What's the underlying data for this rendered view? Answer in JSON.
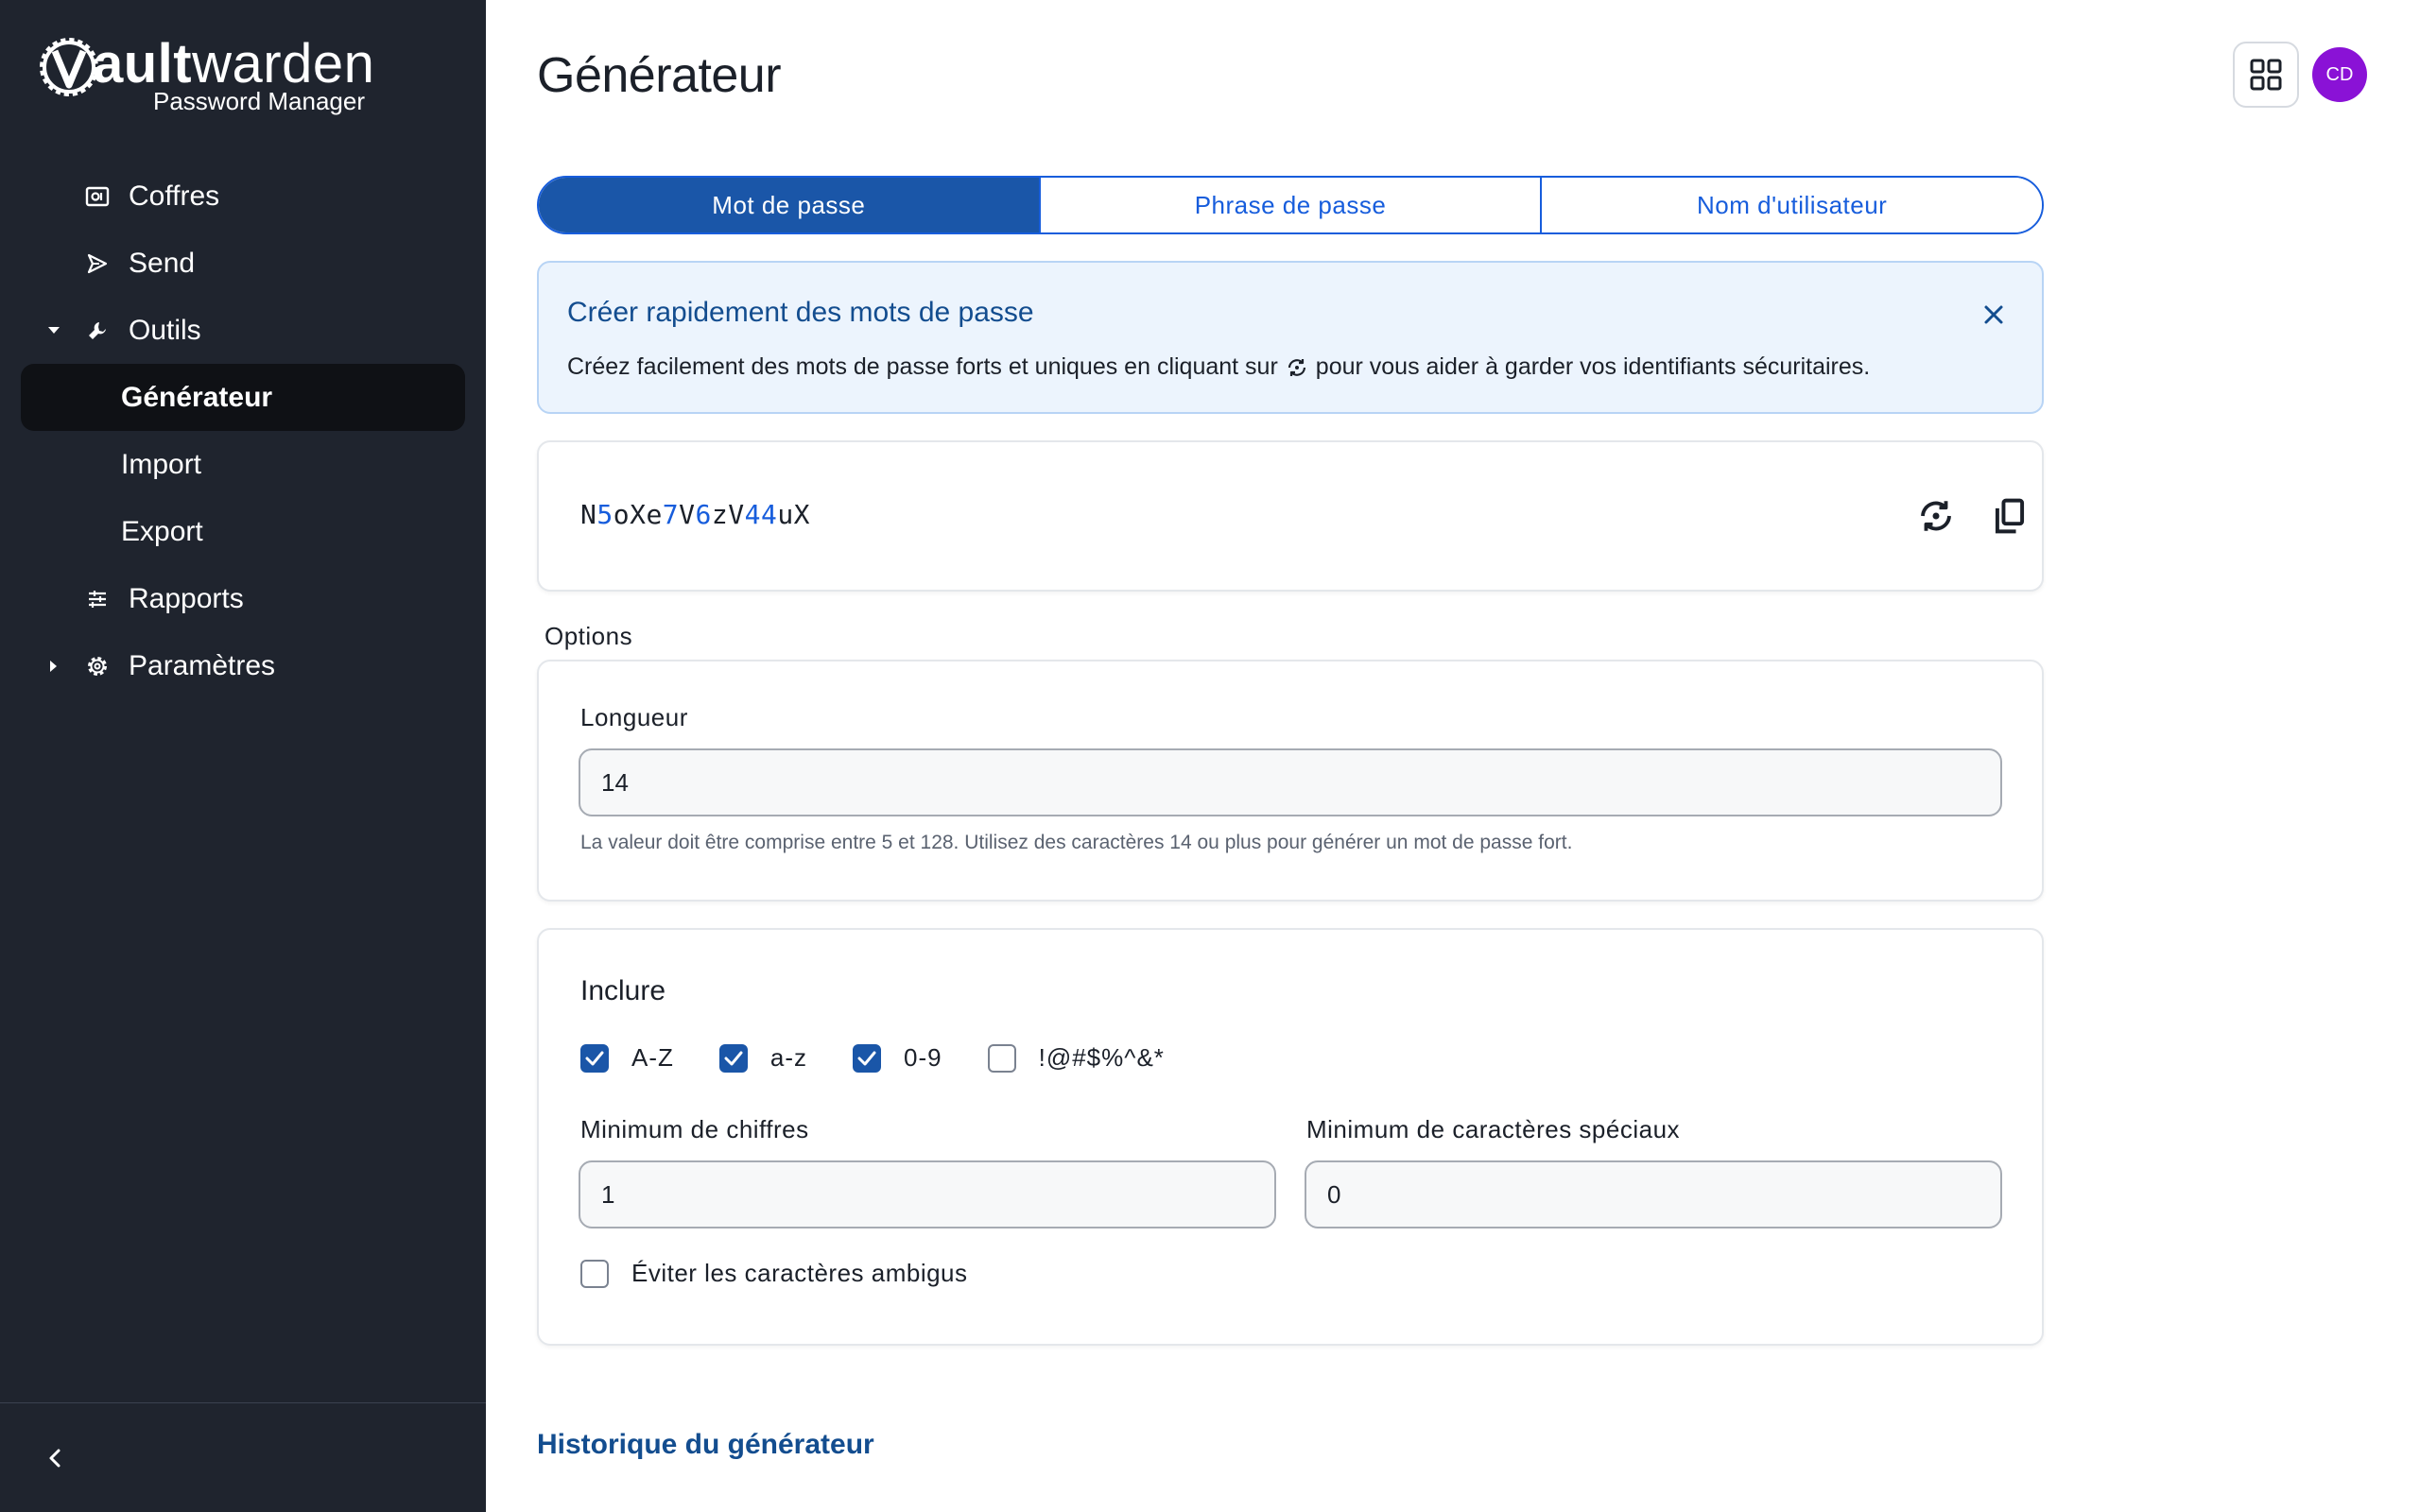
{
  "brand": {
    "name_bold": "V",
    "name_part1": "ault",
    "name_part2": "warden",
    "subtitle": "Password Manager"
  },
  "sidebar": {
    "items": [
      {
        "label": "Coffres",
        "icon": "vault-icon"
      },
      {
        "label": "Send",
        "icon": "send-icon"
      },
      {
        "label": "Outils",
        "icon": "wrench-icon",
        "expanded": true
      },
      {
        "label": "Générateur",
        "active": true
      },
      {
        "label": "Import"
      },
      {
        "label": "Export"
      },
      {
        "label": "Rapports",
        "icon": "sliders-icon"
      },
      {
        "label": "Paramètres",
        "icon": "gear-icon",
        "expanded": false
      }
    ]
  },
  "header": {
    "title": "Générateur",
    "avatar_initials": "CD"
  },
  "tabs": [
    {
      "label": "Mot de passe",
      "selected": true
    },
    {
      "label": "Phrase de passe",
      "selected": false
    },
    {
      "label": "Nom d'utilisateur",
      "selected": false
    }
  ],
  "callout": {
    "title": "Créer rapidement des mots de passe",
    "body_before": "Créez facilement des mots de passe forts et uniques en cliquant sur",
    "body_after": "pour vous aider à garder vos identifiants sécuritaires."
  },
  "generated": {
    "password": "N5oXe7V6zV44uX"
  },
  "options": {
    "section_label": "Options",
    "length_label": "Longueur",
    "length_value": "14",
    "length_hint": "La valeur doit être comprise entre 5 et 128. Utilisez des caractères 14 ou plus pour générer un mot de passe fort.",
    "include_title": "Inclure",
    "charsets": [
      {
        "label": "A-Z",
        "checked": true
      },
      {
        "label": "a-z",
        "checked": true
      },
      {
        "label": "0-9",
        "checked": true
      },
      {
        "label": "!@#$%^&*",
        "checked": false
      }
    ],
    "min_numbers_label": "Minimum de chiffres",
    "min_numbers_value": "1",
    "min_special_label": "Minimum de caractères spéciaux",
    "min_special_value": "0",
    "avoid_ambiguous_label": "Éviter les caractères ambigus",
    "avoid_ambiguous_checked": false
  },
  "history_link": "Historique du générateur",
  "colors": {
    "sidebar_bg": "#1f242e",
    "accent": "#175ddc",
    "tab_selected_bg": "#1a56a8",
    "callout_bg": "#ecf4fd",
    "avatar_bg": "#8a12d6"
  }
}
